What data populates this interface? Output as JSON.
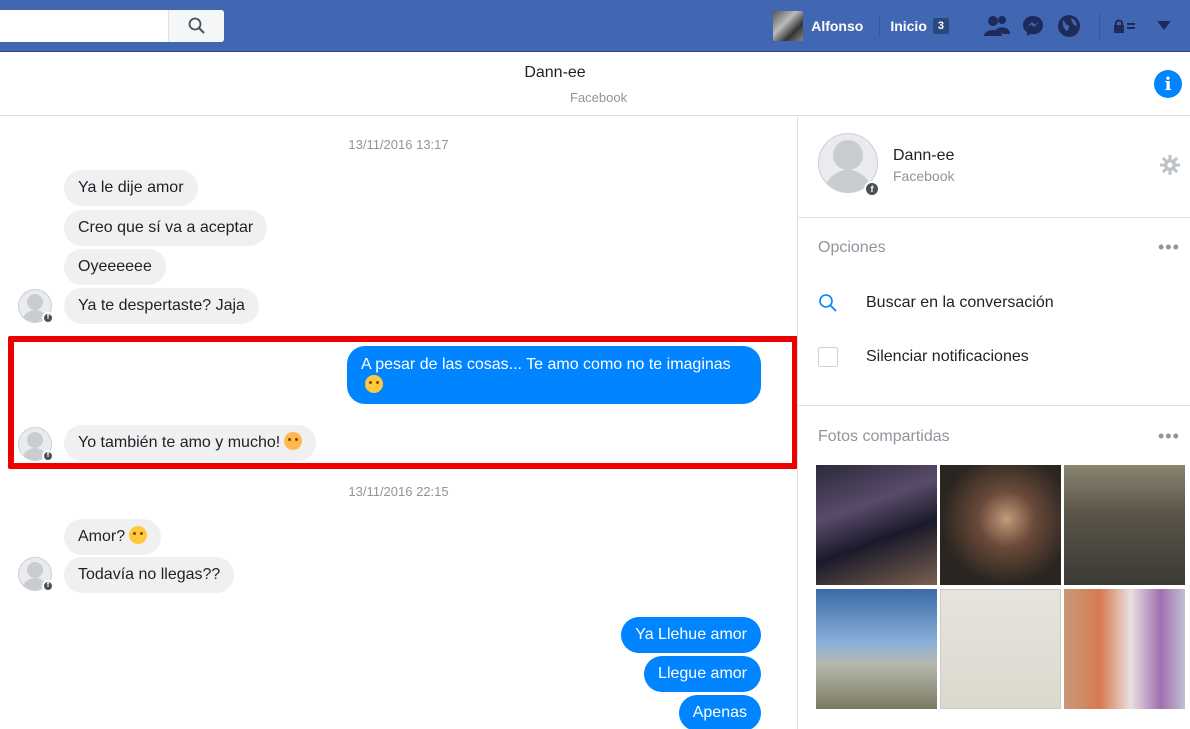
{
  "topbar": {
    "search_placeholder": "",
    "search_icon": "search-icon",
    "user_name": "Alfonso",
    "home_label": "Inicio",
    "home_count": "3",
    "icons": [
      "friends-icon",
      "messenger-icon",
      "globe-icon",
      "privacy-lock-icon",
      "caret-down-icon"
    ],
    "color": "#4267b2"
  },
  "conversation": {
    "name": "Dann-ee",
    "source": "Facebook",
    "info_icon": "i"
  },
  "messages": {
    "time1": "13/11/2016 13:17",
    "m1": "Ya le dije amor",
    "m2": "Creo que sí va a aceptar",
    "m3": "Oyeeeeee",
    "m4": "Ya te despertaste? Jaja",
    "m5": "A pesar de las cosas... Te amo como no te imaginas",
    "m6": "Yo también te amo y mucho!",
    "time2": "13/11/2016 22:15",
    "m7": "Amor?",
    "m8": "Todavía no llegas??",
    "m9": "Ya Llehue amor",
    "m10": "Llegue amor",
    "m11": "Apenas",
    "outgoing_color": "#0084ff",
    "incoming_color": "#f1f0f0",
    "highlight_color": "#ee0000"
  },
  "panel": {
    "name": "Dann-ee",
    "source": "Facebook",
    "options_title": "Opciones",
    "search_option": "Buscar en la conversación",
    "mute_option": "Silenciar notificaciones",
    "photos_title": "Fotos compartidas",
    "more": "•••"
  }
}
